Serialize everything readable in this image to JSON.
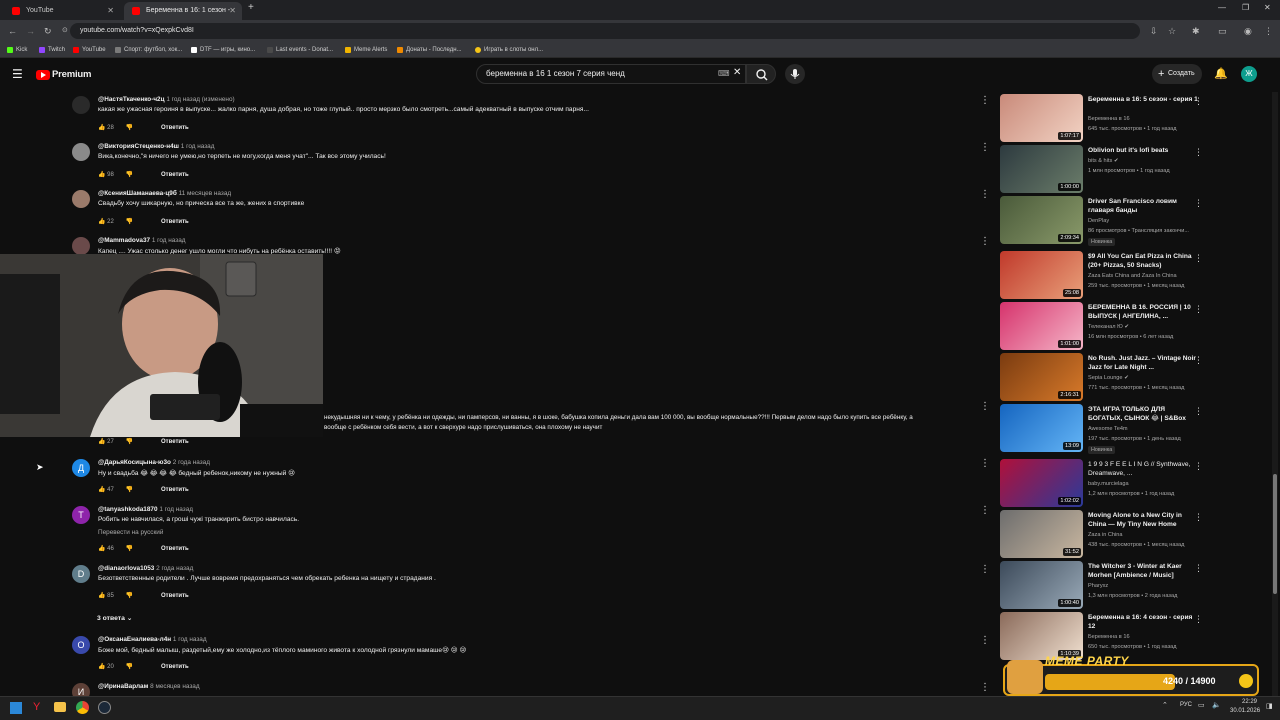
{
  "browser": {
    "tabs": [
      {
        "title": "YouTube",
        "active": false
      },
      {
        "title": "Беременна в 16: 1 сезон - серь...",
        "active": true
      }
    ],
    "new_tab": "+",
    "url": "youtube.com/watch?v=xQexpkCvd8I",
    "bookmarks": [
      "Kick",
      "Twitch",
      "YouTube",
      "Спорт: футбол, хок...",
      "DTF — игры, кино...",
      "Last events - Donat...",
      "Meme Alerts",
      "Донаты - Последн...",
      "Играть в слоты онл..."
    ],
    "bookmark_colors": [
      "#53fc18",
      "#9146ff",
      "#ff0000",
      "#7a7a7a",
      "#ffffff",
      "#4a4a4a",
      "#f0b400",
      "#f08a00",
      "#f5c518"
    ]
  },
  "header": {
    "logo_text": "Premium",
    "search_value": "беременна в 16 1 сезон 7 серия ченд",
    "create_label": "Создать",
    "avatar_letter": "Ж"
  },
  "comments": [
    {
      "author": "@НастяТкаченко-ч2ц",
      "meta": "1 год назад (изменено)",
      "text": "какая же ужасная героиня в выпуске... жалко парня, душа добрая, но тоже глупый.. просто мерзко было смотреть...самый адекватный в выпуске отчим парня...",
      "likes": "28",
      "reply": "Ответить",
      "avatar_letter": "",
      "avatar_color": "#3a3a3a"
    },
    {
      "author": "@ВикторияСтеценко-н4ш",
      "meta": "1 год назад",
      "text": "Вика,конечно,\"я ничего не умею,но терпеть не могу,когда меня учат\"... Так все этому училась!",
      "likes": "98",
      "reply": "Ответить",
      "avatar_letter": "",
      "avatar_color": "#8a8a8a"
    },
    {
      "author": "@КсенияШаманаева-ц9б",
      "meta": "11 месяцев назад",
      "text": "Свадьбу хочу шикарную, но прическа все та же, жених в спортивке",
      "likes": "22",
      "reply": "Ответить",
      "avatar_letter": "",
      "avatar_color": "#9a7a6a"
    },
    {
      "author": "@Mammadova37",
      "meta": "1 год назад",
      "text": "Капец .... Ужас столько денег ушло могли что нибуть на ребёнка оставить!!!! 😡",
      "likes": "",
      "reply": "",
      "avatar_letter": "",
      "avatar_color": "#6a4a4a"
    },
    {
      "author": "",
      "meta": "",
      "text": "некудышняя ни к чему, у ребёнка ни одежды, ни памперсов, ни ванны, я в шоке, бабушка копила деньги дала вам 100 000, вы вообще нормальные??!!! Первым делом надо было купить все ребёнку, а",
      "text2": "вообще с ребёнком себя вести, а вот к сверхуре надо прислушиваться, она плохому не научит",
      "likes": "27",
      "reply": "Ответить",
      "avatar_letter": "",
      "avatar_color": "#444"
    },
    {
      "author": "@ДарьяКосицына-ю3о",
      "meta": "2 года назад",
      "text": "Ну и свадьба 😂 😂 😂 😂 бедный ребенок,никому не нужный 😢",
      "likes": "47",
      "reply": "Ответить",
      "avatar_letter": "Д",
      "avatar_color": "#1e88e5"
    },
    {
      "author": "@tanyashkoda1870",
      "meta": "1 год назад",
      "text": "Робить не навчилася, а гроші чужі транжирить бистро навчилась.",
      "translate": "Перевести на русский",
      "likes": "46",
      "reply": "Ответить",
      "avatar_letter": "T",
      "avatar_color": "#8e24aa"
    },
    {
      "author": "@dianaorlova1053",
      "meta": "2 года назад",
      "text": "Безответственные родители . Лучше вовремя предохраняться чем обрекать ребенка на нищету и страдания .",
      "likes": "85",
      "reply": "Ответить",
      "replies_label": "3 ответа",
      "avatar_letter": "D",
      "avatar_color": "#607d8b"
    },
    {
      "author": "@ОксанаЕналиева-л4н",
      "meta": "1 год назад",
      "text": "Боже мой, бедный малыш, раздетый,ему же холодно,из тёплого маминого живота к холодной грязнули мамаше😢 😢 😢",
      "likes": "20",
      "reply": "Ответить",
      "avatar_letter": "О",
      "avatar_color": "#3949ab"
    },
    {
      "author": "@ИринаВарлам",
      "meta": "8 месяцев назад",
      "text": "",
      "likes": "",
      "reply": "",
      "avatar_letter": "И",
      "avatar_color": "#5d4037"
    }
  ],
  "sidebar": [
    {
      "title": "Беременна в 16: 5 сезон - серия 1",
      "channel": "Беременна в 16",
      "meta": "645 тыс. просмотров • 1 год назад",
      "duration": "1:07:17",
      "thumb": [
        "#c98a7a",
        "#f2d3c4"
      ],
      "verified": false,
      "badge": ""
    },
    {
      "title": "Oblivion but it's lofi beats",
      "channel": "bits & hits",
      "meta": "1 млн просмотров • 1 год назад",
      "duration": "1:00:00",
      "thumb": [
        "#2d3a3f",
        "#6b7d6a"
      ],
      "verified": true,
      "badge": ""
    },
    {
      "title": "Driver San Francisco ловим главаря банды",
      "channel": "DenPlay",
      "meta": "86 просмотров • Трансляция закончи...",
      "duration": "2:09:34",
      "thumb": [
        "#4a5a3a",
        "#8a9a6a"
      ],
      "verified": false,
      "badge": "Новинка"
    },
    {
      "title": "$9 All You Can Eat Pizza in China (20+ Pizzas, 50 Snacks)",
      "channel": "Zaza Eats China and Zaza In China",
      "meta": "259 тыс. просмотров • 1 месяц назад",
      "duration": "25:08",
      "thumb": [
        "#c0392b",
        "#e9a07a"
      ],
      "verified": false,
      "badge": ""
    },
    {
      "title": "БЕРЕМЕННА В 16. РОССИЯ | 10 ВЫПУСК | АНГЕЛИНА, ...",
      "channel": "Телеканал Ю",
      "meta": "16 млн просмотров • 6 лет назад",
      "duration": "1:01:00",
      "thumb": [
        "#d6336c",
        "#f5b6c8"
      ],
      "verified": true,
      "badge": ""
    },
    {
      "title": "No Rush. Just Jazz. – Vintage Noir Jazz for Late Night ...",
      "channel": "Sepia Lounge",
      "meta": "771 тыс. просмотров • 1 месяц назад",
      "duration": "2:16:31",
      "thumb": [
        "#7a3b10",
        "#d87a2a"
      ],
      "verified": true,
      "badge": ""
    },
    {
      "title": "ЭТА ИГРА ТОЛЬКО ДЛЯ БОГАТЫХ, СЫНОК 😂 | S&Box",
      "channel": "Awesome Te4m",
      "meta": "197 тыс. просмотров • 1 день назад",
      "duration": "13:09",
      "thumb": [
        "#1565c0",
        "#64b5f6"
      ],
      "verified": false,
      "badge": "Новинка"
    },
    {
      "title": "1 9 9 3   F E E L I N G // Synthwave, Dreamwave, ...",
      "channel": "baby.murcielaga",
      "meta": "1,2 млн просмотров • 1 год назад",
      "duration": "1:02:02",
      "thumb": [
        "#b0103a",
        "#2a3a9a"
      ],
      "verified": false,
      "badge": ""
    },
    {
      "title": "Moving Alone to a New City in China — My Tiny New Home",
      "channel": "Zaza in China",
      "meta": "438 тыс. просмотров • 1 месяц назад",
      "duration": "31:52",
      "thumb": [
        "#6d6d6d",
        "#c9b7a0"
      ],
      "verified": false,
      "badge": ""
    },
    {
      "title": "The Witcher 3 - Winter at Kaer Morhen [Ambience / Music]",
      "channel": "Pharyxz",
      "meta": "1,3 млн просмотров • 2 года назад",
      "duration": "1:00:40",
      "thumb": [
        "#3c4a5a",
        "#9aaab8"
      ],
      "verified": false,
      "badge": ""
    },
    {
      "title": "Беременна в 16: 4 сезон - серия 12",
      "channel": "Беременна в 16",
      "meta": "650 тыс. просмотров • 1 год назад",
      "duration": "1:10:39",
      "thumb": [
        "#8a6a5a",
        "#f0e0d0"
      ],
      "verified": false,
      "badge": ""
    }
  ],
  "meme_party": {
    "title": "MEME PARTY",
    "progress": "4240 / 14900"
  },
  "taskbar": {
    "lang": "РУС",
    "time": "22:29",
    "date": "30.01.2026"
  }
}
